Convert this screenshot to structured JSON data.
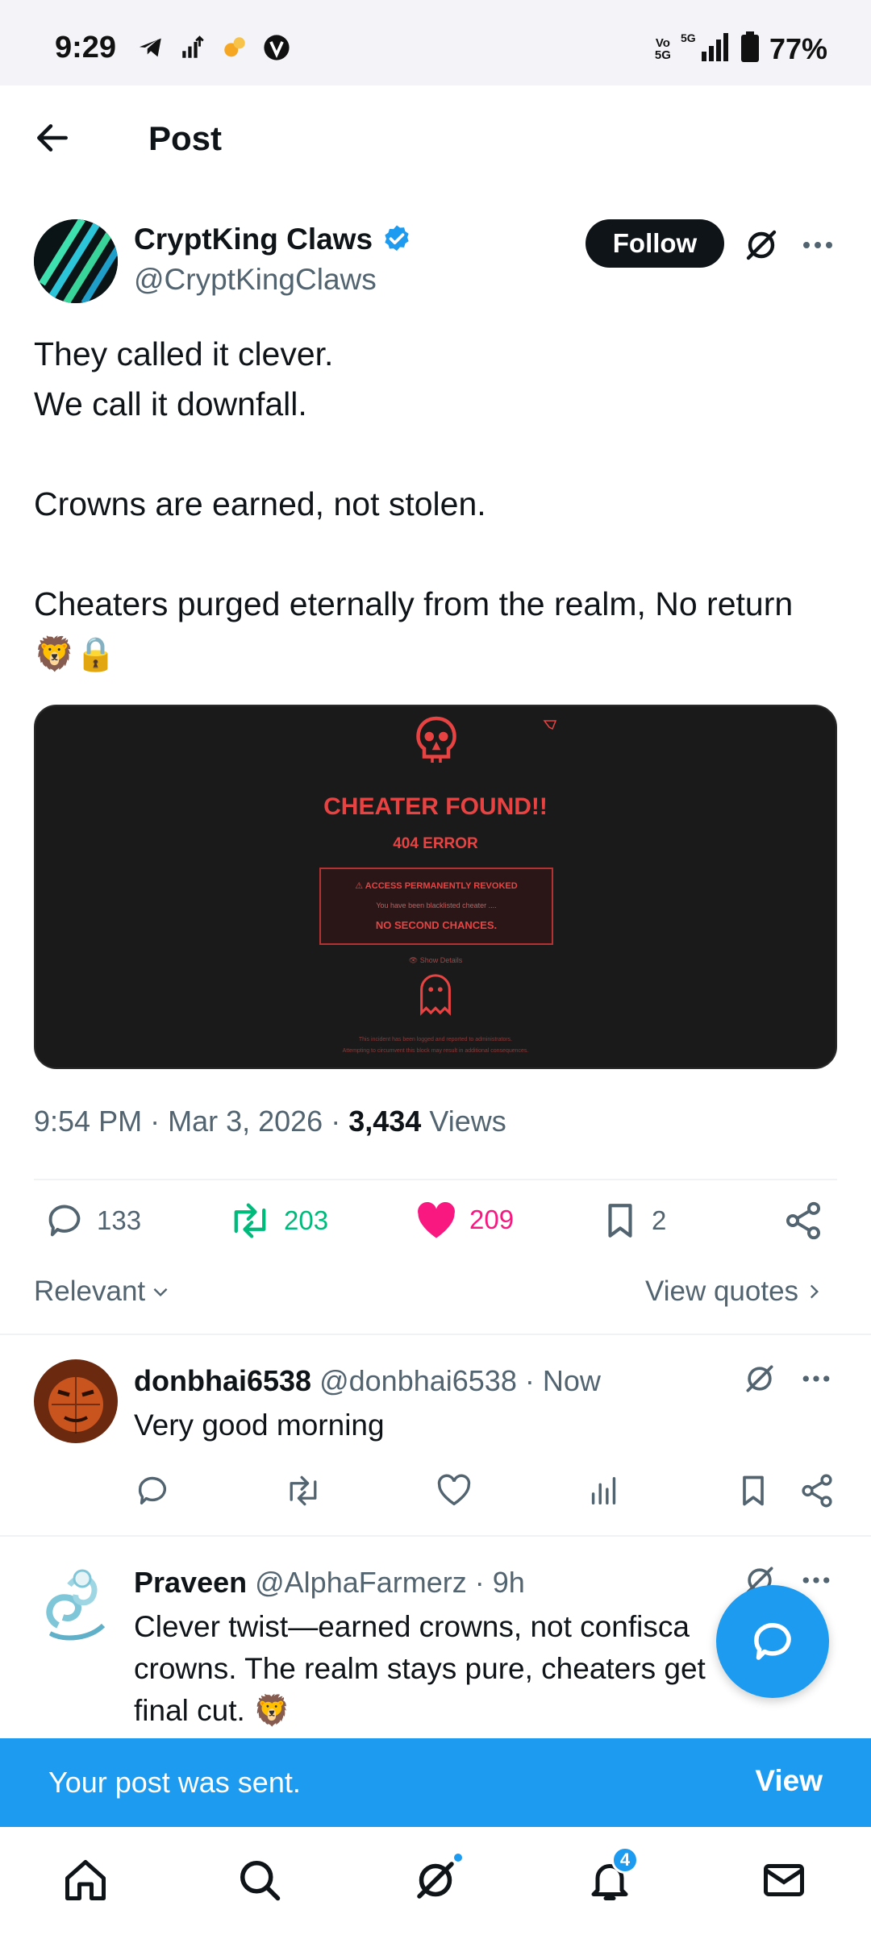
{
  "status_bar": {
    "time": "9:29",
    "network": "5G",
    "volte": "Vo 5G",
    "battery": "77%",
    "icons": [
      "telegram-icon",
      "signal-boost-icon",
      "app-icon",
      "v-badge-icon"
    ]
  },
  "header": {
    "title": "Post"
  },
  "post": {
    "author_name": "CryptKing Claws",
    "author_handle": "@CryptKingClaws",
    "follow_label": "Follow",
    "text": "They called it clever.\nWe call it downfall.\n\nCrowns are earned, not stolen.\n\nCheaters purged eternally from the realm, No return 🦁🔒",
    "media": {
      "heading": "CHEATER FOUND!!",
      "subheading": "404 ERROR",
      "box_title": "⚠ ACCESS PERMANENTLY REVOKED",
      "box_message": "You have been blacklisted cheater ....",
      "box_bold": "NO SECOND CHANCES.",
      "details_link": "👁 Show Details",
      "footer_1": "This incident has been logged and reported to administrators.",
      "footer_2": "Attempting to circumvent this block may result in additional consequences."
    },
    "time": "9:54 PM",
    "date": "Mar 3, 2026",
    "views_count": "3,434",
    "views_label": "Views",
    "replies": "133",
    "reposts": "203",
    "likes": "209",
    "bookmarks": "2"
  },
  "sort": {
    "relevant_label": "Relevant",
    "view_quotes_label": "View quotes"
  },
  "replies": [
    {
      "name": "donbhai6538",
      "meta": "@donbhai6538 · Now",
      "text": "Very good morning"
    },
    {
      "name": "Praveen",
      "meta": "@AlphaFarmerz · 9h",
      "text": "Clever twist—earned crowns, not confisca crowns. The realm stays pure, cheaters get final cut. 🦁"
    }
  ],
  "toast": {
    "message": "Your post was sent.",
    "action": "View"
  },
  "bottom_nav": {
    "notifications_badge": "4"
  },
  "colors": {
    "accent": "#1d9bf0",
    "repost_green": "#00ba7c",
    "like_pink": "#f91880",
    "secondary_text": "#536471"
  }
}
